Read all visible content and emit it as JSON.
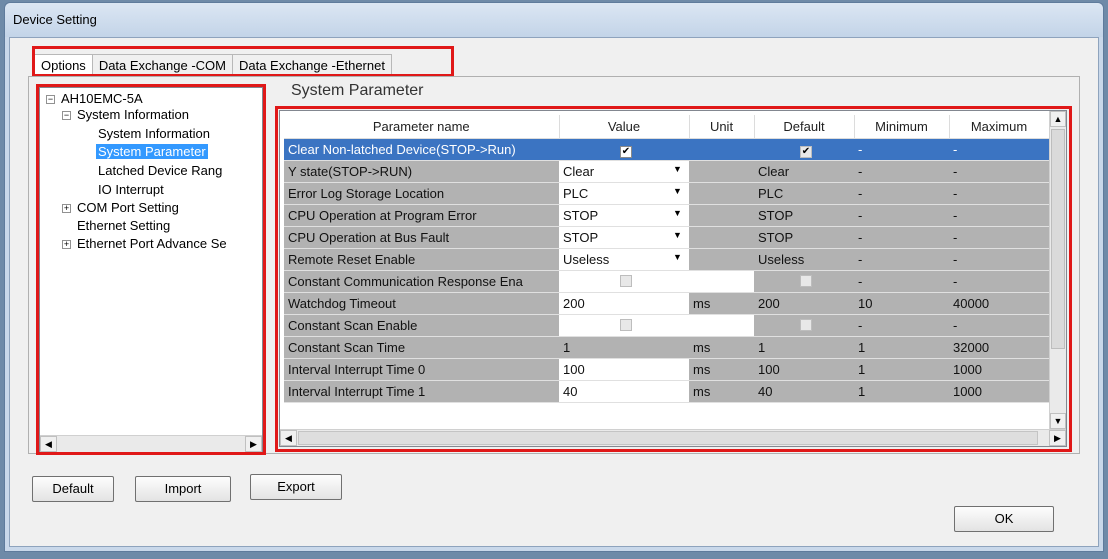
{
  "window": {
    "title": "Device Setting"
  },
  "tabs": [
    "Options",
    "Data Exchange -COM",
    "Data Exchange -Ethernet"
  ],
  "tree": {
    "root": "AH10EMC-5A",
    "system_information": "System Information",
    "system_information_child": "System Information",
    "system_parameter": "System Parameter",
    "latched_device_range": "Latched Device Rang",
    "io_interrupt": "IO Interrupt",
    "com_port_setting": "COM Port Setting",
    "ethernet_setting": "Ethernet Setting",
    "ethernet_port_advance": "Ethernet Port Advance Se"
  },
  "section_title": "System Parameter",
  "grid": {
    "headers": {
      "name": "Parameter name",
      "value": "Value",
      "unit": "Unit",
      "default": "Default",
      "minimum": "Minimum",
      "maximum": "Maximum"
    },
    "rows": [
      {
        "name": "Clear Non-latched Device(STOP->Run)",
        "value": "",
        "unit": "",
        "default": "",
        "minimum": "-",
        "maximum": "-"
      },
      {
        "name": "Y state(STOP->RUN)",
        "value": "Clear",
        "unit": "",
        "default": "Clear",
        "minimum": "-",
        "maximum": "-"
      },
      {
        "name": "Error Log Storage Location",
        "value": "PLC",
        "unit": "",
        "default": "PLC",
        "minimum": "-",
        "maximum": "-"
      },
      {
        "name": "CPU Operation at Program Error",
        "value": "STOP",
        "unit": "",
        "default": "STOP",
        "minimum": "-",
        "maximum": "-"
      },
      {
        "name": "CPU Operation at Bus Fault",
        "value": "STOP",
        "unit": "",
        "default": "STOP",
        "minimum": "-",
        "maximum": "-"
      },
      {
        "name": "Remote Reset Enable",
        "value": "Useless",
        "unit": "",
        "default": "Useless",
        "minimum": "-",
        "maximum": "-"
      },
      {
        "name": "Constant Communication Response Ena",
        "value": "",
        "unit": "",
        "default": "",
        "minimum": "-",
        "maximum": "-"
      },
      {
        "name": "Watchdog Timeout",
        "value": "200",
        "unit": "ms",
        "default": "200",
        "minimum": "10",
        "maximum": "40000"
      },
      {
        "name": "Constant Scan Enable",
        "value": "",
        "unit": "",
        "default": "",
        "minimum": "-",
        "maximum": "-"
      },
      {
        "name": "Constant Scan Time",
        "value": "1",
        "unit": "ms",
        "default": "1",
        "minimum": "1",
        "maximum": "32000"
      },
      {
        "name": "Interval Interrupt Time 0",
        "value": "100",
        "unit": "ms",
        "default": "100",
        "minimum": "1",
        "maximum": "1000"
      },
      {
        "name": "Interval Interrupt Time 1",
        "value": "40",
        "unit": "ms",
        "default": "40",
        "minimum": "1",
        "maximum": "1000"
      }
    ]
  },
  "buttons": {
    "default": "Default",
    "import": "Import",
    "export": "Export",
    "ok": "OK"
  },
  "colors": {
    "highlight_box": "#e01818",
    "selection": "#3b74c2",
    "tree_selection": "#3399ff"
  }
}
